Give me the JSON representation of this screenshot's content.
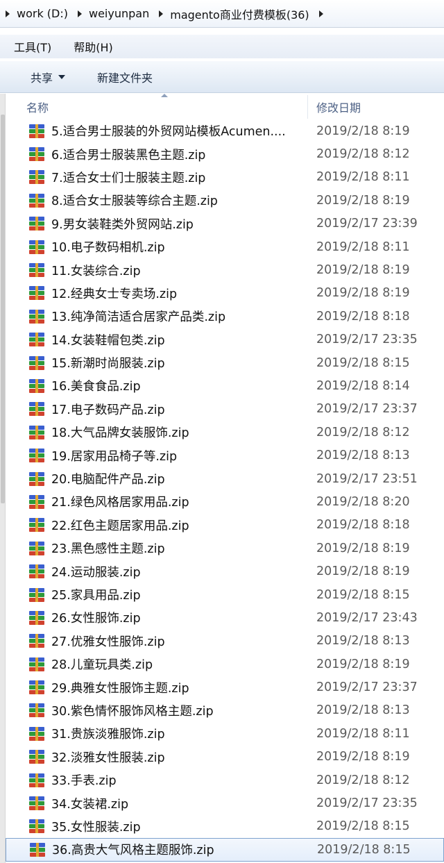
{
  "breadcrumb": [
    "work (D:)",
    "weiyunpan",
    "magento商业付费模板(36)"
  ],
  "menu": {
    "tools": "工具(T)",
    "help": "帮助(H)"
  },
  "toolbar": {
    "share": "共享",
    "new_folder": "新建文件夹"
  },
  "columns": {
    "name": "名称",
    "date": "修改日期"
  },
  "files": [
    {
      "name": "5.适合男士服装的外贸网站模板Acumen....",
      "date": "2019/2/18 8:19"
    },
    {
      "name": "6.适合男士服装黑色主题.zip",
      "date": "2019/2/18 8:12"
    },
    {
      "name": "7.适合女士们士服装主题.zip",
      "date": "2019/2/18 8:11"
    },
    {
      "name": "8.适合女士服装等综合主题.zip",
      "date": "2019/2/18 8:19"
    },
    {
      "name": "9.男女装鞋类外贸网站.zip",
      "date": "2019/2/17 23:39"
    },
    {
      "name": "10.电子数码相机.zip",
      "date": "2019/2/18 8:11"
    },
    {
      "name": "11.女装综合.zip",
      "date": "2019/2/18 8:19"
    },
    {
      "name": "12.经典女士专卖场.zip",
      "date": "2019/2/18 8:19"
    },
    {
      "name": "13.纯净简洁适合居家产品类.zip",
      "date": "2019/2/18 8:18"
    },
    {
      "name": "14.女装鞋帽包类.zip",
      "date": "2019/2/17 23:35"
    },
    {
      "name": "15.新潮时尚服装.zip",
      "date": "2019/2/18 8:15"
    },
    {
      "name": "16.美食食品.zip",
      "date": "2019/2/18 8:14"
    },
    {
      "name": "17.电子数码产品.zip",
      "date": "2019/2/17 23:37"
    },
    {
      "name": "18.大气品牌女装服饰.zip",
      "date": "2019/2/18 8:12"
    },
    {
      "name": "19.居家用品椅子等.zip",
      "date": "2019/2/18 8:13"
    },
    {
      "name": "20.电脑配件产品.zip",
      "date": "2019/2/17 23:51"
    },
    {
      "name": "21.绿色风格居家用品.zip",
      "date": "2019/2/18 8:20"
    },
    {
      "name": "22.红色主题居家用品.zip",
      "date": "2019/2/18 8:18"
    },
    {
      "name": "23.黑色感性主题.zip",
      "date": "2019/2/18 8:19"
    },
    {
      "name": "24.运动服装.zip",
      "date": "2019/2/18 8:19"
    },
    {
      "name": "25.家具用品.zip",
      "date": "2019/2/18 8:15"
    },
    {
      "name": "26.女性服饰.zip",
      "date": "2019/2/17 23:43"
    },
    {
      "name": "27.优雅女性服饰.zip",
      "date": "2019/2/18 8:13"
    },
    {
      "name": "28.儿童玩具类.zip",
      "date": "2019/2/18 8:19"
    },
    {
      "name": "29.典雅女性服饰主题.zip",
      "date": "2019/2/17 23:37"
    },
    {
      "name": "30.紫色情怀服饰风格主题.zip",
      "date": "2019/2/18 8:13"
    },
    {
      "name": "31.贵族淡雅服饰.zip",
      "date": "2019/2/18 8:11"
    },
    {
      "name": "32.淡雅女性服装.zip",
      "date": "2019/2/18 8:19"
    },
    {
      "name": "33.手表.zip",
      "date": "2019/2/18 8:12"
    },
    {
      "name": "34.女装裙.zip",
      "date": "2019/2/17 23:35"
    },
    {
      "name": "35.女性服装.zip",
      "date": "2019/2/18 8:15"
    },
    {
      "name": "36.高贵大气风格主题服饰.zip",
      "date": "2019/2/18 8:15",
      "selected": true
    }
  ]
}
